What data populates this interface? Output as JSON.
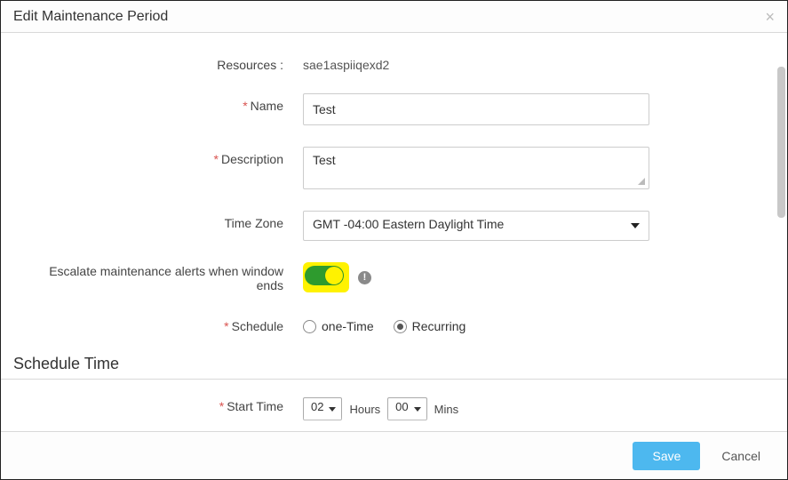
{
  "header": {
    "title": "Edit Maintenance Period"
  },
  "form": {
    "labels": {
      "resources": "Resources :",
      "name": "Name",
      "description": "Description",
      "timezone": "Time Zone",
      "escalate": "Escalate maintenance alerts when window ends",
      "schedule": "Schedule",
      "startTime": "Start Time"
    },
    "values": {
      "resources": "sae1aspiiqexd2",
      "name": "Test",
      "description": "Test",
      "timezone": "GMT -04:00 Eastern Daylight Time",
      "escalate_on": true,
      "schedule_options": {
        "onetime": "one-Time",
        "recurring": "Recurring"
      },
      "schedule_selected": "recurring",
      "start_hours": "02",
      "start_mins": "00",
      "units": {
        "hours": "Hours",
        "mins": "Mins"
      }
    }
  },
  "sections": {
    "scheduleTime": "Schedule Time"
  },
  "footer": {
    "save": "Save",
    "cancel": "Cancel"
  },
  "icons": {
    "info_glyph": "!"
  }
}
